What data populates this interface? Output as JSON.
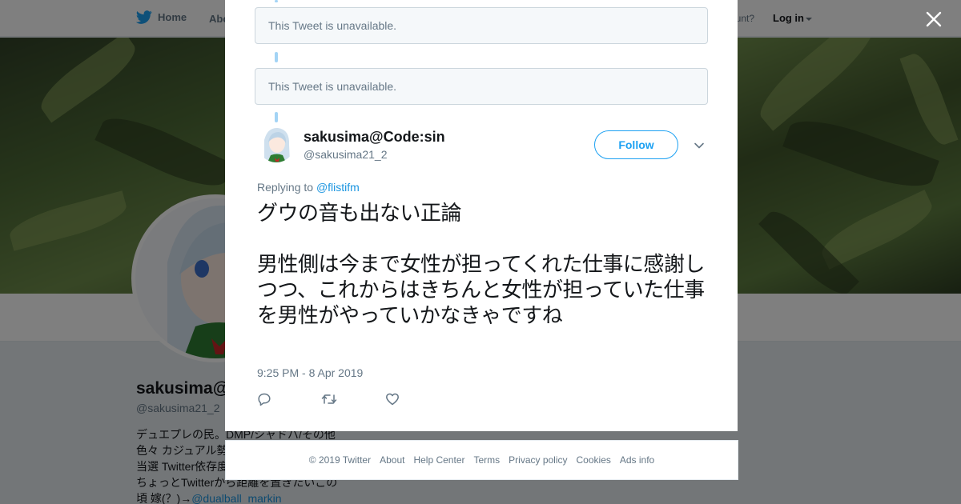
{
  "nav": {
    "home": "Home",
    "about": "Abo",
    "account": "ccount?",
    "login": "Log in"
  },
  "profile": {
    "name": "sakusima@",
    "handle": "@sakusima21_2",
    "bio_lines": [
      "デュエプレの民。DMP/シャドバ/その他",
      "色々 カジュアル勢",
      "当選 Twitter依存度",
      "ちょっとTwitterから距離を置きたいこの",
      "頃 嫁(？)→"
    ],
    "bio_link": "@dualball_markin"
  },
  "thread": {
    "unavailable_1": "This Tweet is unavailable.",
    "unavailable_2": "This Tweet is unavailable."
  },
  "tweet": {
    "name": "sakusima@Code:sin",
    "handle": "@sakusima21_2",
    "follow_label": "Follow",
    "replying_prefix": "Replying to",
    "replying_to": "@flistifm",
    "text": "グウの音も出ない正論\n\n男性側は今まで女性が担ってくれた仕事に感謝しつつ、これからはきちんと女性が担っていた仕事を男性がやっていかなきゃですね",
    "timestamp": "9:25 PM - 8 Apr 2019"
  },
  "footer": {
    "copyright": "© 2019 Twitter",
    "links": [
      "About",
      "Help Center",
      "Terms",
      "Privacy policy",
      "Cookies",
      "Ads info"
    ]
  },
  "colors": {
    "accent": "#1da1f2",
    "link": "#1b95e0",
    "muted": "#657786",
    "thread_line": "#a3d4f5"
  }
}
